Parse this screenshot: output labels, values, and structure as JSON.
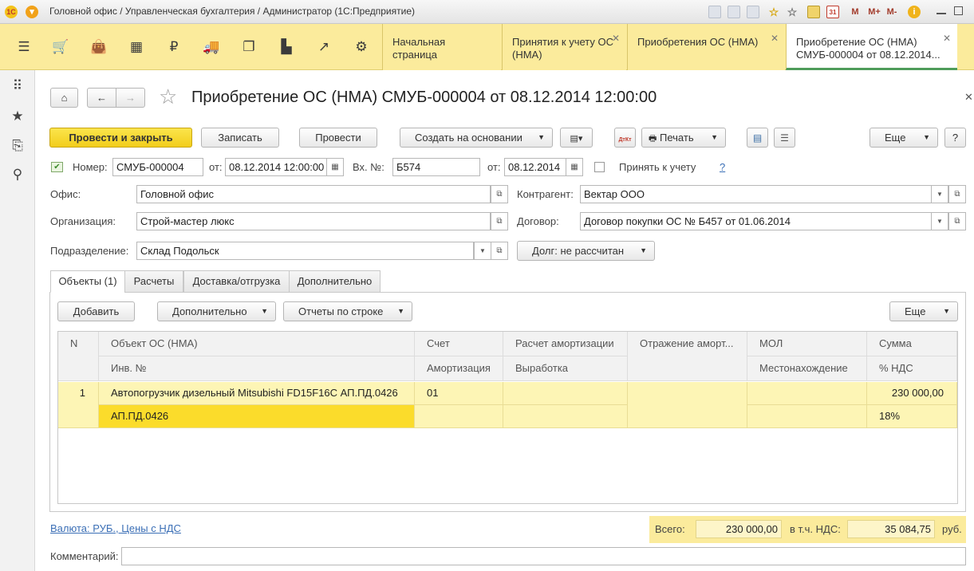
{
  "window": {
    "title": "Головной офис / Управленческая бухгалтерия / Администратор  (1С:Предприятие)"
  },
  "titlebar_icons": {
    "m": "M",
    "m_plus": "M+",
    "m_minus": "M-",
    "info": "i"
  },
  "tabs": [
    {
      "label": "Начальная страница"
    },
    {
      "label": "Принятия к учету ОС (НМА)"
    },
    {
      "label": "Приобретения ОС (НМА)"
    },
    {
      "label": "Приобретение ОС (НМА) СМУБ-000004 от 08.12.2014..."
    }
  ],
  "document": {
    "title": "Приобретение ОС (НМА) СМУБ-000004 от 08.12.2014 12:00:00"
  },
  "toolbar": {
    "post_close": "Провести и закрыть",
    "save": "Записать",
    "post": "Провести",
    "create_based": "Создать на основании",
    "dt_kt": "ДтКт",
    "print": "Печать",
    "more": "Еще",
    "help": "?"
  },
  "header": {
    "number_label": "Номер:",
    "number": "СМУБ-000004",
    "from_label": "от:",
    "date": "08.12.2014 12:00:00",
    "incoming_label": "Вх. №:",
    "incoming": "Б574",
    "from2_label": "от:",
    "incoming_date": "08.12.2014",
    "accept_label": "Принять к учету",
    "help": "?"
  },
  "fields": {
    "office_label": "Офис:",
    "office": "Головной офис",
    "org_label": "Организация:",
    "org": "Строй-мастер люкс",
    "dept_label": "Подразделение:",
    "dept": "Склад Подольск",
    "contractor_label": "Контрагент:",
    "contractor": "Вектар ООО",
    "contract_label": "Договор:",
    "contract": "Договор покупки ОС № Б457 от 01.06.2014",
    "debt": "Долг: не рассчитан"
  },
  "form_tabs": [
    {
      "label": "Объекты (1)"
    },
    {
      "label": "Расчеты"
    },
    {
      "label": "Доставка/отгрузка"
    },
    {
      "label": "Дополнительно"
    }
  ],
  "table_toolbar": {
    "add": "Добавить",
    "extra": "Дополнительно",
    "reports": "Отчеты по строке",
    "more": "Еще"
  },
  "table": {
    "headers_top": [
      "N",
      "Объект ОС (НМА)",
      "Счет",
      "Расчет амортизации",
      "Отражение аморт...",
      "МОЛ",
      "Сумма"
    ],
    "headers_bottom": [
      "Инв. №",
      "Амортизация",
      "Выработка",
      "Местонахождение",
      "% НДС"
    ],
    "rows": [
      {
        "n": "1",
        "object": "Автопогрузчик дизельный Mitsubishi FD15F16C АП.ПД.0426",
        "account": "01",
        "amort_calc": "",
        "amort_reflect": "",
        "mol": "",
        "sum": "230 000,00",
        "inv": "АП.ПД.0426",
        "amort": "",
        "output": "",
        "location": "",
        "vat": "18%"
      }
    ]
  },
  "footer": {
    "currency_link": "Валюта: РУБ., Цены с НДС",
    "total_label": "Всего:",
    "total": "230 000,00",
    "vat_label": "в т.ч. НДС:",
    "vat": "35 084,75",
    "currency": "руб.",
    "comment_label": "Комментарий:",
    "comment": ""
  }
}
